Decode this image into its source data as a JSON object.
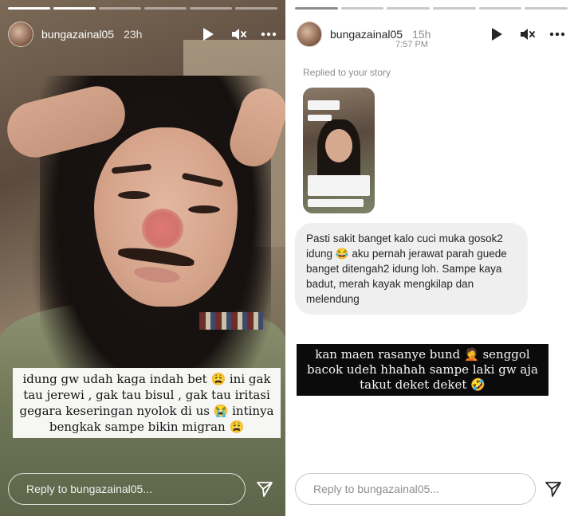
{
  "left_story": {
    "username": "bungazainal05",
    "time": "23h",
    "caption": "idung gw udah kaga indah bet 😩 ini gak tau jerewi , gak tau bisul , gak tau iritasi gegara keseringan nyolok di us 😭 intinya bengkak sampe bikin migran 😩",
    "reply_placeholder": "Reply to bungazainal05...",
    "progress": {
      "segments": 6,
      "completed": 2
    }
  },
  "right_story": {
    "username": "bungazainal05",
    "time": "15h",
    "timestamp": "7:57 PM",
    "replied_label": "Replied to your story",
    "message": "Pasti sakit banget kalo cuci muka gosok2 idung 😂 aku pernah jerawat parah guede banget ditengah2 idung loh. Sampe kaya badut, merah kayak mengkilap dan melendung",
    "sticker_text": "kan maen rasanye bund 🤦 senggol bacok udeh hhahah sampe laki gw aja takut deket deket 🤣",
    "reply_placeholder": "Reply to bungazainal05...",
    "progress": {
      "segments": 6,
      "completed": 1
    }
  },
  "icons": {
    "play": "play-icon",
    "mute": "mute-icon",
    "more": "more-icon",
    "send": "send-icon"
  },
  "colors": {
    "bubble": "#efefef",
    "sticker_bg": "#0b0b0b",
    "caption_bg": "#f6f6f4"
  }
}
